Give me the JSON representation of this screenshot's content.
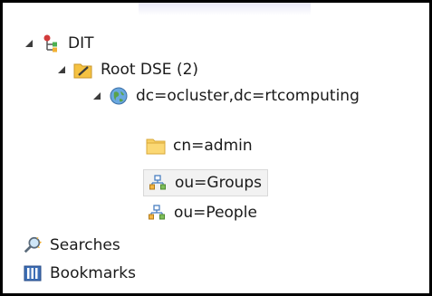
{
  "tree": {
    "dit": {
      "label": "DIT",
      "icon": "dit-hierarchy-icon"
    },
    "root_dse": {
      "label": "Root DSE (2)",
      "icon": "root-dse-folder-icon"
    },
    "domain": {
      "label": "dc=ocluster,dc=rtcomputing",
      "icon": "globe-icon"
    },
    "admin": {
      "label": "cn=admin",
      "icon": "folder-icon"
    },
    "groups": {
      "label": "ou=Groups",
      "icon": "org-unit-icon",
      "selected": true
    },
    "people": {
      "label": "ou=People",
      "icon": "org-unit-icon"
    },
    "searches": {
      "label": "Searches",
      "icon": "searches-icon"
    },
    "bookmarks": {
      "label": "Bookmarks",
      "icon": "bookmarks-icon"
    }
  },
  "colors": {
    "selection_bg": "#f2f2f2",
    "folder": "#f5c242",
    "orgunit": "#4a7fc1"
  }
}
